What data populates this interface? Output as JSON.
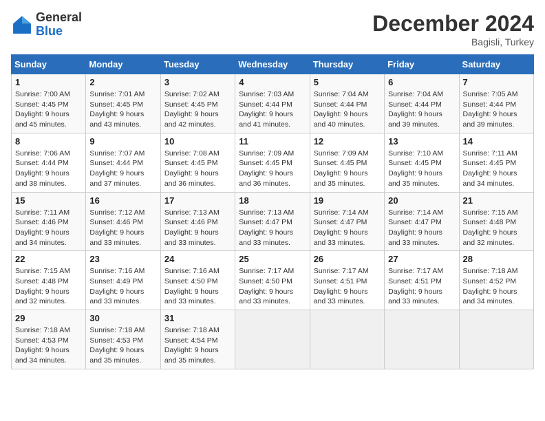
{
  "header": {
    "logo_general": "General",
    "logo_blue": "Blue",
    "title": "December 2024",
    "location": "Bagisli, Turkey"
  },
  "days_of_week": [
    "Sunday",
    "Monday",
    "Tuesday",
    "Wednesday",
    "Thursday",
    "Friday",
    "Saturday"
  ],
  "weeks": [
    [
      {
        "num": "1",
        "sunrise": "7:00 AM",
        "sunset": "4:45 PM",
        "daylight": "9 hours and 45 minutes."
      },
      {
        "num": "2",
        "sunrise": "7:01 AM",
        "sunset": "4:45 PM",
        "daylight": "9 hours and 43 minutes."
      },
      {
        "num": "3",
        "sunrise": "7:02 AM",
        "sunset": "4:45 PM",
        "daylight": "9 hours and 42 minutes."
      },
      {
        "num": "4",
        "sunrise": "7:03 AM",
        "sunset": "4:44 PM",
        "daylight": "9 hours and 41 minutes."
      },
      {
        "num": "5",
        "sunrise": "7:04 AM",
        "sunset": "4:44 PM",
        "daylight": "9 hours and 40 minutes."
      },
      {
        "num": "6",
        "sunrise": "7:04 AM",
        "sunset": "4:44 PM",
        "daylight": "9 hours and 39 minutes."
      },
      {
        "num": "7",
        "sunrise": "7:05 AM",
        "sunset": "4:44 PM",
        "daylight": "9 hours and 39 minutes."
      }
    ],
    [
      {
        "num": "8",
        "sunrise": "7:06 AM",
        "sunset": "4:44 PM",
        "daylight": "9 hours and 38 minutes."
      },
      {
        "num": "9",
        "sunrise": "7:07 AM",
        "sunset": "4:44 PM",
        "daylight": "9 hours and 37 minutes."
      },
      {
        "num": "10",
        "sunrise": "7:08 AM",
        "sunset": "4:45 PM",
        "daylight": "9 hours and 36 minutes."
      },
      {
        "num": "11",
        "sunrise": "7:09 AM",
        "sunset": "4:45 PM",
        "daylight": "9 hours and 36 minutes."
      },
      {
        "num": "12",
        "sunrise": "7:09 AM",
        "sunset": "4:45 PM",
        "daylight": "9 hours and 35 minutes."
      },
      {
        "num": "13",
        "sunrise": "7:10 AM",
        "sunset": "4:45 PM",
        "daylight": "9 hours and 35 minutes."
      },
      {
        "num": "14",
        "sunrise": "7:11 AM",
        "sunset": "4:45 PM",
        "daylight": "9 hours and 34 minutes."
      }
    ],
    [
      {
        "num": "15",
        "sunrise": "7:11 AM",
        "sunset": "4:46 PM",
        "daylight": "9 hours and 34 minutes."
      },
      {
        "num": "16",
        "sunrise": "7:12 AM",
        "sunset": "4:46 PM",
        "daylight": "9 hours and 33 minutes."
      },
      {
        "num": "17",
        "sunrise": "7:13 AM",
        "sunset": "4:46 PM",
        "daylight": "9 hours and 33 minutes."
      },
      {
        "num": "18",
        "sunrise": "7:13 AM",
        "sunset": "4:47 PM",
        "daylight": "9 hours and 33 minutes."
      },
      {
        "num": "19",
        "sunrise": "7:14 AM",
        "sunset": "4:47 PM",
        "daylight": "9 hours and 33 minutes."
      },
      {
        "num": "20",
        "sunrise": "7:14 AM",
        "sunset": "4:47 PM",
        "daylight": "9 hours and 33 minutes."
      },
      {
        "num": "21",
        "sunrise": "7:15 AM",
        "sunset": "4:48 PM",
        "daylight": "9 hours and 32 minutes."
      }
    ],
    [
      {
        "num": "22",
        "sunrise": "7:15 AM",
        "sunset": "4:48 PM",
        "daylight": "9 hours and 32 minutes."
      },
      {
        "num": "23",
        "sunrise": "7:16 AM",
        "sunset": "4:49 PM",
        "daylight": "9 hours and 33 minutes."
      },
      {
        "num": "24",
        "sunrise": "7:16 AM",
        "sunset": "4:50 PM",
        "daylight": "9 hours and 33 minutes."
      },
      {
        "num": "25",
        "sunrise": "7:17 AM",
        "sunset": "4:50 PM",
        "daylight": "9 hours and 33 minutes."
      },
      {
        "num": "26",
        "sunrise": "7:17 AM",
        "sunset": "4:51 PM",
        "daylight": "9 hours and 33 minutes."
      },
      {
        "num": "27",
        "sunrise": "7:17 AM",
        "sunset": "4:51 PM",
        "daylight": "9 hours and 33 minutes."
      },
      {
        "num": "28",
        "sunrise": "7:18 AM",
        "sunset": "4:52 PM",
        "daylight": "9 hours and 34 minutes."
      }
    ],
    [
      {
        "num": "29",
        "sunrise": "7:18 AM",
        "sunset": "4:53 PM",
        "daylight": "9 hours and 34 minutes."
      },
      {
        "num": "30",
        "sunrise": "7:18 AM",
        "sunset": "4:53 PM",
        "daylight": "9 hours and 35 minutes."
      },
      {
        "num": "31",
        "sunrise": "7:18 AM",
        "sunset": "4:54 PM",
        "daylight": "9 hours and 35 minutes."
      },
      null,
      null,
      null,
      null
    ]
  ],
  "labels": {
    "sunrise": "Sunrise:",
    "sunset": "Sunset:",
    "daylight": "Daylight:"
  }
}
